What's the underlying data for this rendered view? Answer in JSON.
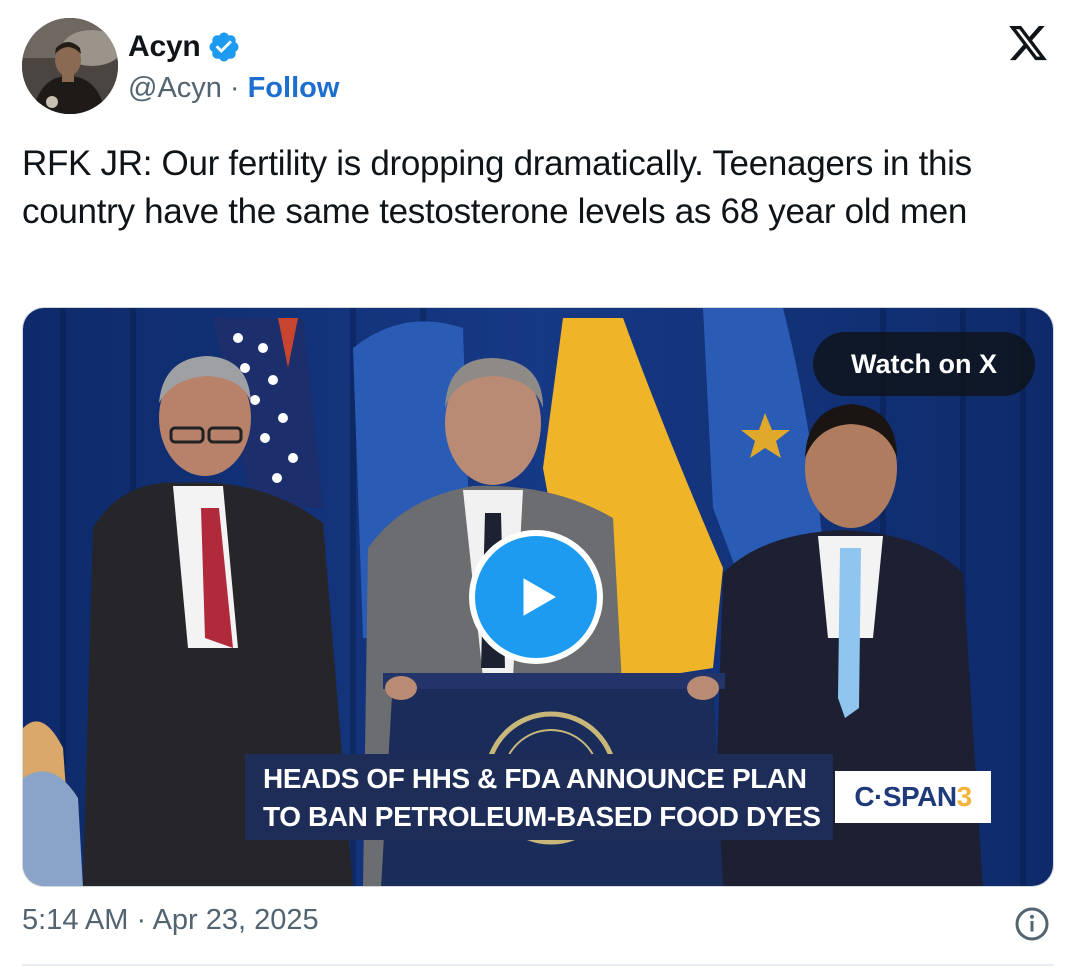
{
  "author": {
    "display_name": "Acyn",
    "handle": "@Acyn",
    "separator": "·",
    "follow_label": "Follow",
    "verified": true
  },
  "tweet": {
    "text": "RFK JR: Our fertility is dropping dramatically. Teenagers in this country have the same testosterone levels as 68 year old men"
  },
  "media": {
    "watch_label": "Watch on X",
    "chyron_line1": "HEADS OF HHS & FDA ANNOUNCE PLAN",
    "chyron_line2": "TO BAN PETROLEUM-BASED FOOD DYES",
    "network_logo_main": "C·SPAN",
    "network_logo_num": "3"
  },
  "footer": {
    "timestamp": "5:14 AM · Apr 23, 2025"
  },
  "colors": {
    "follow": "#1d6fcf",
    "play_button": "#1d9bf0",
    "verified_badge": "#1d9bf0",
    "muted_text": "#536471"
  },
  "icons": [
    "verified-badge-icon",
    "x-logo-icon",
    "play-icon",
    "info-icon"
  ]
}
